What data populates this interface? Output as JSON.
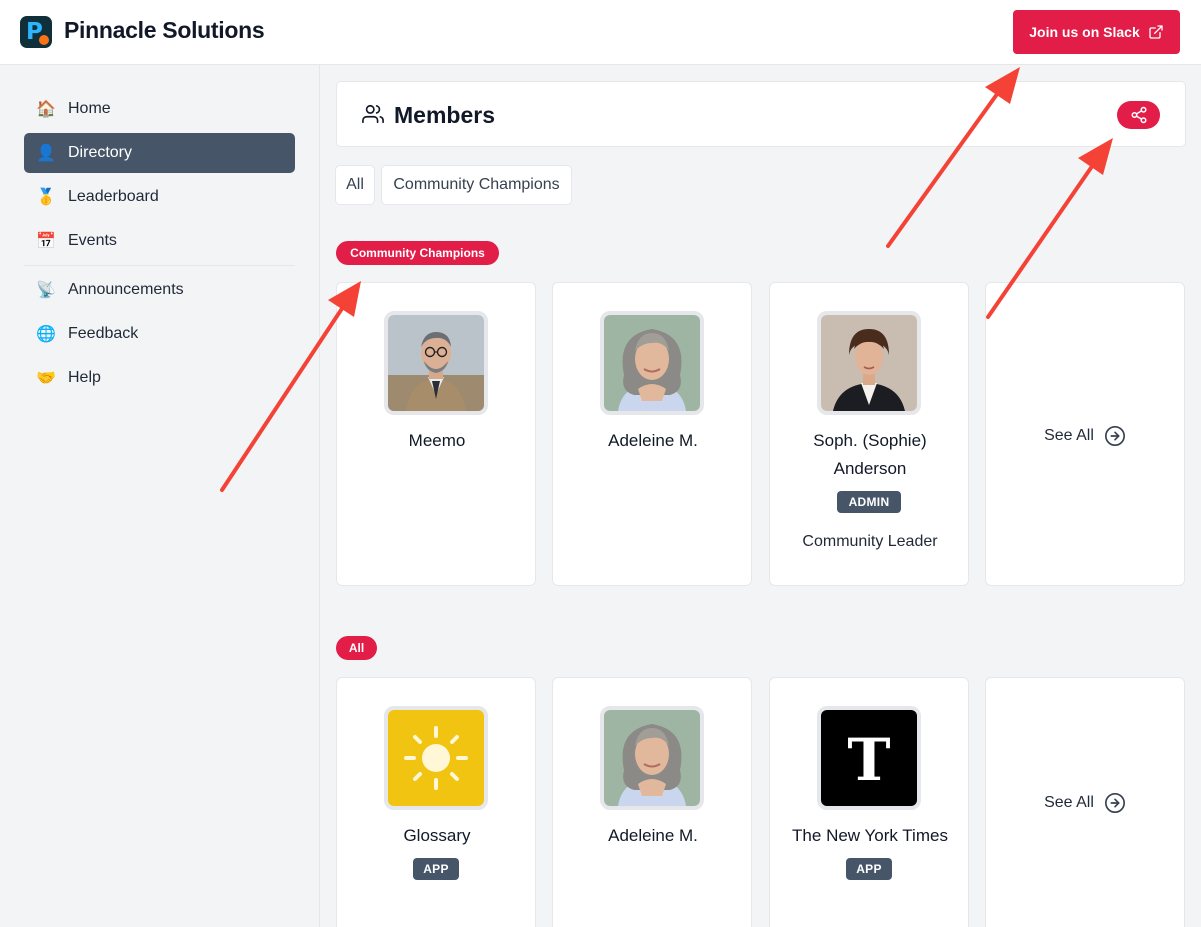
{
  "header": {
    "brand": "Pinnacle Solutions",
    "slack_button": "Join us on Slack"
  },
  "sidebar": {
    "items": [
      {
        "label": "Home",
        "icon": "house-icon"
      },
      {
        "label": "Directory",
        "icon": "person-card-icon",
        "active": true
      },
      {
        "label": "Leaderboard",
        "icon": "medal-icon"
      },
      {
        "label": "Events",
        "icon": "calendar-icon"
      },
      {
        "label": "Announcements",
        "icon": "satellite-dish-icon"
      },
      {
        "label": "Feedback",
        "icon": "globe-icon"
      },
      {
        "label": "Help",
        "icon": "handshake-icon"
      }
    ]
  },
  "main": {
    "title": "Members",
    "filters": [
      "All",
      "Community Champions"
    ],
    "sections": [
      {
        "label": "Community Champions",
        "cards": [
          {
            "name": "Meemo"
          },
          {
            "name": "Adeleine M."
          },
          {
            "name_line1": "Soph. (Sophie)",
            "name_line2": "Anderson",
            "badge": "ADMIN",
            "subtitle": "Community Leader"
          },
          {
            "see_all": "See All"
          }
        ]
      },
      {
        "label": "All",
        "cards": [
          {
            "name": "Glossary",
            "badge": "APP"
          },
          {
            "name": "Adeleine M."
          },
          {
            "name": "The New York Times",
            "badge": "APP"
          },
          {
            "see_all": "See All"
          }
        ]
      }
    ]
  },
  "colors": {
    "accent": "#e11d48",
    "active_nav": "#475569",
    "annotation_arrow": "#f44336"
  }
}
